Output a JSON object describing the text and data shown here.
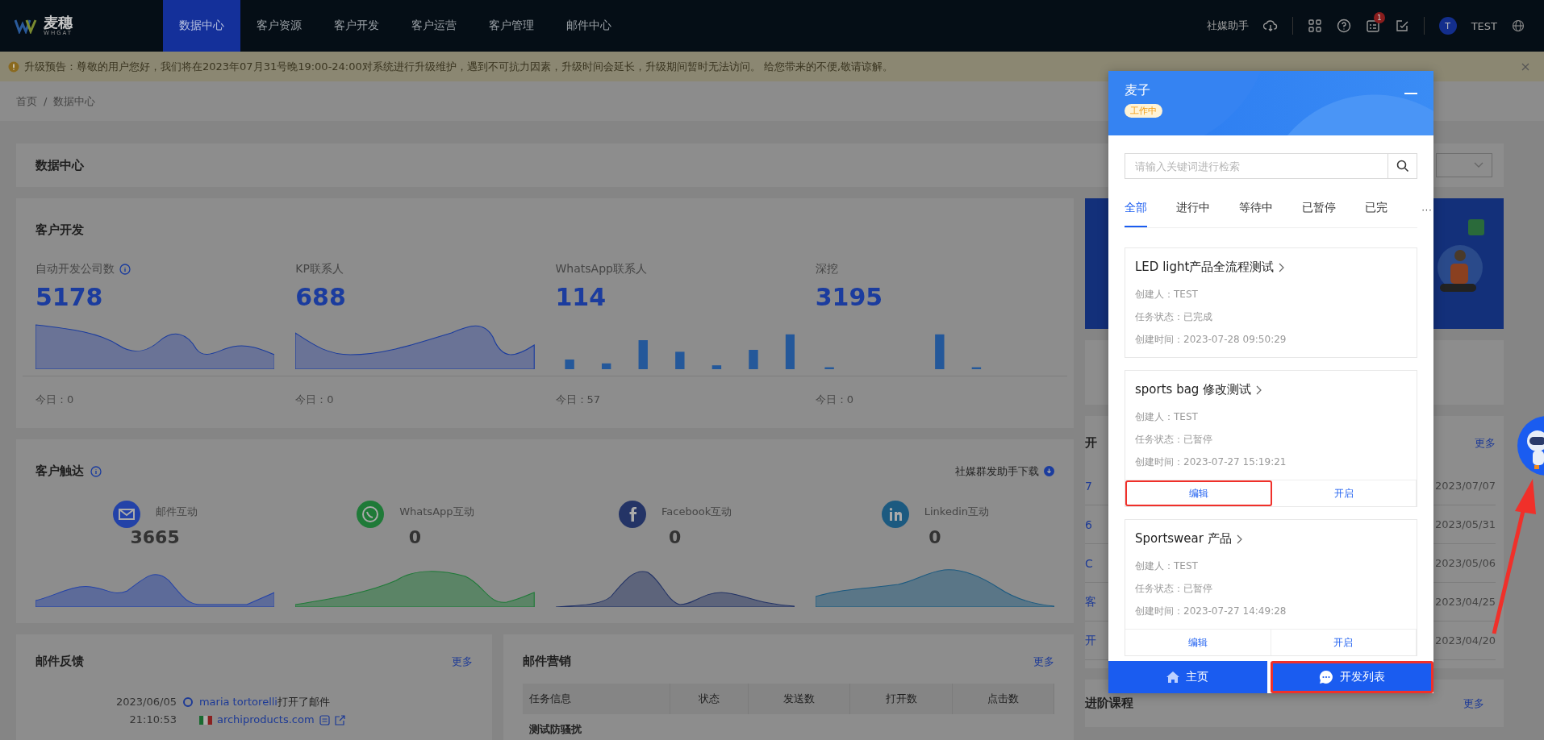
{
  "nav": {
    "brand": "麦穗",
    "brand_sub": "WHGAT",
    "menu": [
      {
        "label": "数据中心",
        "selected": true
      },
      {
        "label": "客户资源",
        "selected": false
      },
      {
        "label": "客户开发",
        "selected": false
      },
      {
        "label": "客户运营",
        "selected": false
      },
      {
        "label": "客户管理",
        "selected": false
      },
      {
        "label": "邮件中心",
        "selected": false
      }
    ],
    "assistant": "社媒助手",
    "notification_count": "1",
    "user_initial": "T",
    "user": "TEST"
  },
  "notice": {
    "text": "升级预告：尊敬的用户您好，我们将在2023年07月31号晚19:00-24:00对系统进行升级维护，遇到不可抗力因素，升级时间会延长，升级期间暂时无法访问。 给您带来的不便,敬请谅解。"
  },
  "breadcrumb": [
    "首页",
    "数据中心"
  ],
  "breadcrumb_separator": "/",
  "page_title": "数据中心",
  "customer_development": {
    "title": "客户开发",
    "stats": [
      {
        "label": "自动开发公司数",
        "info": true,
        "kind": "area",
        "value": "5178",
        "today": "今日：0"
      },
      {
        "label": "KP联系人",
        "info": false,
        "kind": "area",
        "value": "688",
        "today": "今日：0"
      },
      {
        "label": "WhatsApp联系人",
        "info": false,
        "kind": "bar",
        "value": "114",
        "today": "今日：57"
      },
      {
        "label": "深挖",
        "info": false,
        "kind": "bar",
        "value": "3195",
        "today": "今日：0"
      }
    ]
  },
  "customer_reach": {
    "title": "客户触达",
    "download": "社媒群发助手下载",
    "channels": [
      {
        "kind": "email",
        "label": "邮件互动",
        "value": "3665",
        "color": "#2342a8"
      },
      {
        "kind": "whatsapp",
        "label": "WhatsApp互动",
        "value": "0",
        "color": "#1f7a38"
      },
      {
        "kind": "facebook",
        "label": "Facebook互动",
        "value": "0",
        "color": "#243466"
      },
      {
        "kind": "linkedin",
        "label": "Linkedin互动",
        "value": "0",
        "color": "#1c5a80"
      }
    ]
  },
  "email_feedback": {
    "title": "邮件反馈",
    "more": "更多",
    "entries": [
      {
        "date": "2023/06/05",
        "time": "21:10:53",
        "contact": "maria tortorelli",
        "action": "打开了邮件",
        "domain": "archiproducts.com"
      }
    ]
  },
  "email_marketing": {
    "title": "邮件营销",
    "more": "更多",
    "columns": [
      "任务信息",
      "状态",
      "发送数",
      "打开数",
      "点击数"
    ],
    "rows": [
      {
        "task": "测试防骚扰"
      }
    ]
  },
  "right_column": {
    "list_title": "开",
    "more": "更多",
    "rows": [
      {
        "fragment": "7",
        "date": "2023/07/07"
      },
      {
        "fragment": "6",
        "date": "2023/05/31"
      },
      {
        "fragment": "C",
        "date": "2023/05/06"
      },
      {
        "fragment": "客",
        "date": "2023/04/25"
      },
      {
        "fragment": "开",
        "date": "2023/04/20"
      }
    ],
    "courses_title": "进阶课程",
    "courses_more": "更多"
  },
  "popup": {
    "title": "麦子",
    "status": "工作中",
    "search_placeholder": "请输入关键词进行检索",
    "tabs": [
      {
        "label": "全部",
        "selected": true
      },
      {
        "label": "进行中",
        "selected": false
      },
      {
        "label": "等待中",
        "selected": false
      },
      {
        "label": "已暂停",
        "selected": false
      },
      {
        "label": "已完",
        "selected": false
      }
    ],
    "more_tabs": "···",
    "tasks": [
      {
        "name": "LED light产品全流程测试",
        "creator": "创建人：TEST",
        "status": "任务状态：已完成",
        "created": "创建时间：2023-07-28 09:50:29"
      },
      {
        "name": "sports bag 修改测试",
        "creator": "创建人：TEST",
        "status": "任务状态：已暂停",
        "created": "创建时间：2023-07-27 15:19:21",
        "actions": [
          {
            "label": "编辑",
            "highlighted": true
          },
          {
            "label": "开启",
            "highlighted": false
          }
        ]
      },
      {
        "name": "Sportswear 产品",
        "creator": "创建人：TEST",
        "status": "任务状态：已暂停",
        "created": "创建时间：2023-07-27 14:49:28",
        "actions": [
          {
            "label": "编辑",
            "highlighted": false
          },
          {
            "label": "开启",
            "highlighted": false
          }
        ]
      }
    ],
    "footer": [
      {
        "kind": "home",
        "label": "主页",
        "highlighted": false
      },
      {
        "kind": "chat",
        "label": "开发列表",
        "highlighted": true
      }
    ]
  }
}
